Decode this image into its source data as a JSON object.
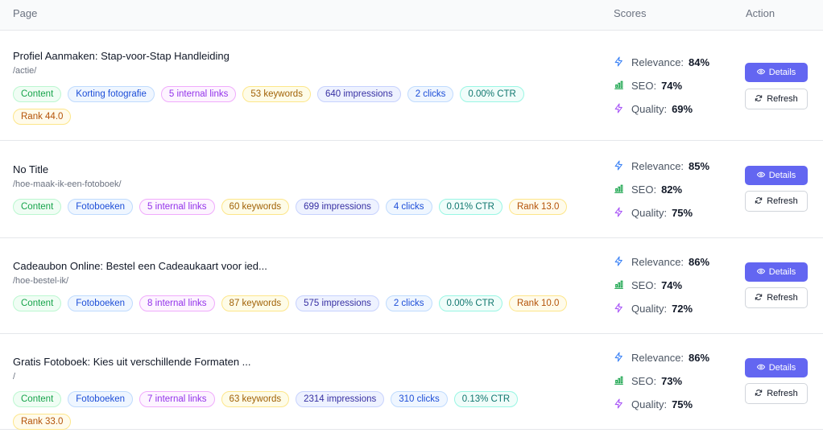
{
  "header": {
    "page": "Page",
    "scores": "Scores",
    "action": "Action"
  },
  "colors": {
    "accent": "#6366f1",
    "tag_content": "#16a34a",
    "tag_category": "#1d4ed8",
    "tag_links": "#9333ea",
    "tag_keywords": "#a16207",
    "tag_impressions": "#3730a3",
    "tag_clicks": "#1d4ed8",
    "tag_ctr": "#0f766e",
    "tag_rank": "#b45309"
  },
  "rows": [
    {
      "title": "Profiel Aanmaken: Stap-voor-Stap Handleiding",
      "path": "/actie/",
      "tags": {
        "type": "Content",
        "category": "Korting fotografie",
        "links": "5 internal links",
        "keywords": "53 keywords",
        "impressions": "640 impressions",
        "clicks": "2 clicks",
        "ctr": "0.00% CTR",
        "rank": "Rank 44.0"
      },
      "scores": {
        "relevance_label": "Relevance:",
        "relevance": "84%",
        "seo_label": "SEO:",
        "seo": "74%",
        "quality_label": "Quality:",
        "quality": "69%"
      },
      "details_label": "Details",
      "refresh_label": "Refresh"
    },
    {
      "title": "No Title",
      "path": "/hoe-maak-ik-een-fotoboek/",
      "tags": {
        "type": "Content",
        "category": "Fotoboeken",
        "links": "5 internal links",
        "keywords": "60 keywords",
        "impressions": "699 impressions",
        "clicks": "4 clicks",
        "ctr": "0.01% CTR",
        "rank": "Rank 13.0"
      },
      "scores": {
        "relevance_label": "Relevance:",
        "relevance": "85%",
        "seo_label": "SEO:",
        "seo": "82%",
        "quality_label": "Quality:",
        "quality": "75%"
      },
      "details_label": "Details",
      "refresh_label": "Refresh"
    },
    {
      "title": "Cadeaubon Online: Bestel een Cadeaukaart voor ied...",
      "path": "/hoe-bestel-ik/",
      "tags": {
        "type": "Content",
        "category": "Fotoboeken",
        "links": "8 internal links",
        "keywords": "87 keywords",
        "impressions": "575 impressions",
        "clicks": "2 clicks",
        "ctr": "0.00% CTR",
        "rank": "Rank 10.0"
      },
      "scores": {
        "relevance_label": "Relevance:",
        "relevance": "86%",
        "seo_label": "SEO:",
        "seo": "74%",
        "quality_label": "Quality:",
        "quality": "72%"
      },
      "details_label": "Details",
      "refresh_label": "Refresh"
    },
    {
      "title": "Gratis Fotoboek: Kies uit verschillende Formaten ...",
      "path": "/",
      "tags": {
        "type": "Content",
        "category": "Fotoboeken",
        "links": "7 internal links",
        "keywords": "63 keywords",
        "impressions": "2314 impressions",
        "clicks": "310 clicks",
        "ctr": "0.13% CTR",
        "rank": "Rank 33.0"
      },
      "scores": {
        "relevance_label": "Relevance:",
        "relevance": "86%",
        "seo_label": "SEO:",
        "seo": "73%",
        "quality_label": "Quality:",
        "quality": "75%"
      },
      "details_label": "Details",
      "refresh_label": "Refresh"
    }
  ]
}
